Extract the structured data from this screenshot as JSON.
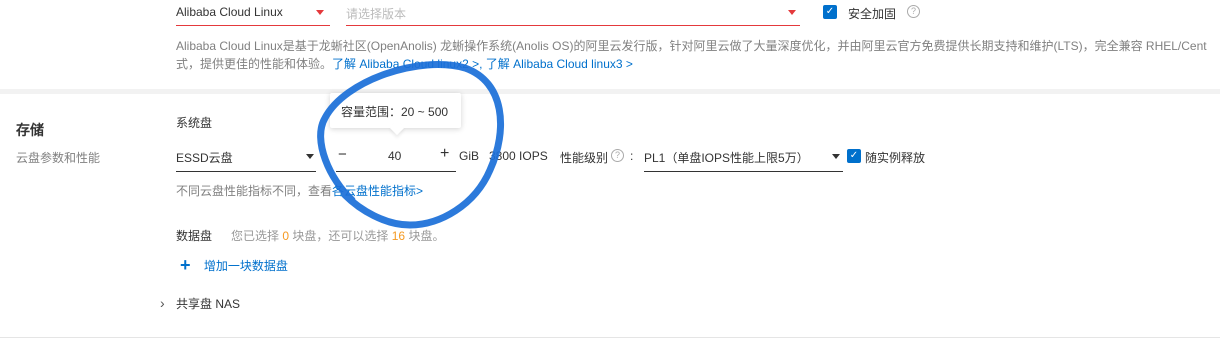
{
  "os": {
    "image_select": "Alibaba Cloud Linux",
    "version_placeholder": "请选择版本",
    "security_label": "安全加固",
    "desc_line1": "Alibaba Cloud Linux是基于龙蜥社区(OpenAnolis) 龙蜥操作系统(Anolis OS)的阿里云发行版，针对阿里云做了大量深度优化，并由阿里云官方免费提供长期支持和维护(LTS)，完全兼容 RHEL/Cent",
    "desc_line2_prefix": "式，提供更佳的性能和体验。",
    "link_linux2": "了解 Alibaba Cloud linux2 >",
    "link_sep": ",",
    "link_linux3": "了解 Alibaba Cloud linux3 >"
  },
  "storage": {
    "title": "存储",
    "subtitle": "云盘参数和性能",
    "system_disk_label": "系统盘",
    "tooltip": "容量范围：20 ~ 500",
    "disk_type": "ESSD云盘",
    "minus": "−",
    "size_value": "40",
    "plus": "+",
    "unit": "GiB",
    "iops": "3800 IOPS",
    "perf_level_label": "性能级别",
    "perf_colon": ":",
    "perf_level_value": "PL1（单盘IOPS性能上限5万）",
    "release_label": "随实例释放",
    "hint_prefix": "不同云盘性能指标不同，查看",
    "hint_link": "各云盘性能指标>",
    "data_disk_label": "数据盘",
    "data_disk_info_pre": "您已选择",
    "data_disk_selected": "0",
    "data_disk_info_mid": "块盘，还可以选择",
    "data_disk_remaining": "16",
    "data_disk_info_post": "块盘。",
    "add_icon": "+",
    "add_data_disk": "增加一块数据盘",
    "nas_chevron": "›",
    "nas_label": "共享盘 NAS"
  },
  "colors": {
    "accent": "#0070cc",
    "red": "#e4393c",
    "orange": "#f59a23",
    "annotation": "#1a6fd8"
  }
}
